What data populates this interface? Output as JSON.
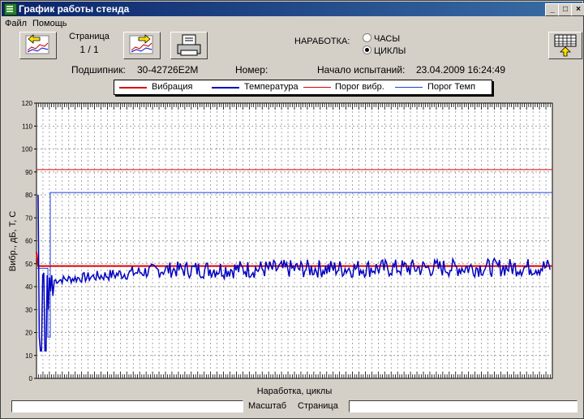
{
  "window": {
    "title": "График работы стенда",
    "controls": [
      "_",
      "□",
      "×"
    ]
  },
  "menu": [
    "Файл",
    "Помощь"
  ],
  "toolbar": {
    "page_label": "Страница",
    "page_value": "1 / 1",
    "mode_label": "НАРАБОТКА:",
    "options": [
      "ЧАСЫ",
      "ЦИКЛЫ"
    ],
    "selected_option": "ЦИКЛЫ"
  },
  "info": {
    "bearing_label": "Подшипник:",
    "bearing_value": "30-42726E2M",
    "number_label": "Номер:",
    "number_value": "",
    "start_label": "Начало испытаний:",
    "start_value": "23.04.2009 16:24:49"
  },
  "legend": [
    {
      "name": "Вибрация",
      "color": "#e00000",
      "thick": true
    },
    {
      "name": "Температура",
      "color": "#0000c0",
      "thick": true
    },
    {
      "name": "Порог вибр.",
      "color": "#e00000",
      "thick": false
    },
    {
      "name": "Порог Темп",
      "color": "#2040e0",
      "thick": false
    }
  ],
  "chart_data": {
    "type": "line",
    "xlabel": "Наработка, циклы",
    "ylabel": "Вибр., дБ,  Т, С",
    "ylim": [
      0,
      120
    ],
    "yticks": [
      0,
      10,
      20,
      30,
      40,
      50,
      60,
      70,
      80,
      90,
      100,
      110,
      120
    ],
    "grid": true,
    "thresholds": {
      "vibration": 91,
      "temperature": 81
    },
    "vibration_level": 49,
    "temperature_level": 48
  },
  "status": {
    "tabs": [
      "Масштаб",
      "Страница"
    ]
  }
}
